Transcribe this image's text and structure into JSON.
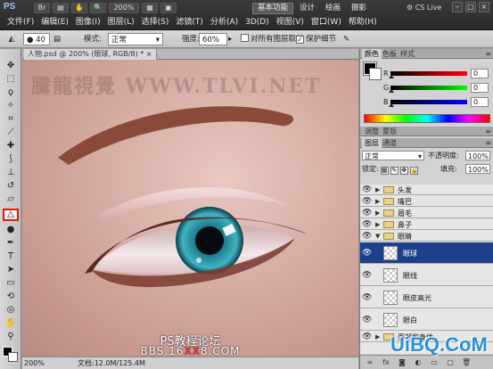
{
  "app": {
    "logo": "PS",
    "zoom": "200%",
    "cs_live": "CS Live"
  },
  "workspaces": [
    "基本功能",
    "设计",
    "绘画",
    "摄影"
  ],
  "menus": [
    "文件(F)",
    "编辑(E)",
    "图像(I)",
    "图层(L)",
    "选择(S)",
    "滤镜(T)",
    "分析(A)",
    "3D(D)",
    "视图(V)",
    "窗口(W)",
    "帮助(H)"
  ],
  "options": {
    "brush_size": "40",
    "mode_label": "模式:",
    "mode_value": "正常",
    "strength_label": "强度:",
    "strength_value": "60%",
    "sample_all_layers": "对所有图层取样",
    "protect_detail": "保护细节",
    "protect_detail_checked": true
  },
  "document": {
    "tab_label": "人物.psd @ 200% (眼球, RGB/8) *",
    "watermark": "騰龍視覺 WWW.TLVI.NET",
    "forum_title": "PS教程论坛",
    "forum_url_prefix": "BBS.16",
    "forum_url_red": "XX",
    "forum_url_suffix": "8.COM"
  },
  "status": {
    "zoom": "200%",
    "doc_size": "文档:12.0M/125.4M"
  },
  "color_panel": {
    "tabs": [
      "颜色",
      "色板",
      "样式"
    ],
    "r_label": "R",
    "g_label": "G",
    "b_label": "B",
    "r_value": "0",
    "g_value": "0",
    "b_value": "0"
  },
  "adjust_tabs": [
    "调整",
    "蒙版"
  ],
  "layers_panel": {
    "tabs": [
      "图层",
      "通道"
    ],
    "blend_mode": "正常",
    "opacity_label": "不透明度:",
    "opacity_value": "100%",
    "lock_label": "锁定:",
    "fill_label": "填充:",
    "fill_value": "100%",
    "layers": [
      {
        "name": "头发",
        "type": "group"
      },
      {
        "name": "嘴巴",
        "type": "group"
      },
      {
        "name": "眉毛",
        "type": "group"
      },
      {
        "name": "鼻子",
        "type": "group"
      },
      {
        "name": "眼睛",
        "type": "group"
      },
      {
        "name": "眼球",
        "type": "layer"
      },
      {
        "name": "眼线",
        "type": "layer"
      },
      {
        "name": "眼皮高光",
        "type": "layer"
      },
      {
        "name": "眼白",
        "type": "layer"
      },
      {
        "name": "面部和身体",
        "type": "group"
      }
    ]
  },
  "site_watermark": "UiBQ.CoM",
  "colors": {
    "selected_layer": "#1e3f8c",
    "tool_highlight": "#e01818",
    "iris": "#1f7f8f"
  },
  "icons": [
    "move-icon",
    "marquee-icon",
    "lasso-icon",
    "quick-select-icon",
    "crop-icon",
    "eyedropper-icon",
    "healing-icon",
    "brush-icon",
    "clone-stamp-icon",
    "history-brush-icon",
    "eraser-icon",
    "gradient-icon",
    "sharpen-icon",
    "dodge-icon",
    "pen-icon",
    "type-icon",
    "path-select-icon",
    "shape-icon",
    "3d-rotate-icon",
    "3d-orbit-icon",
    "hand-icon",
    "zoom-icon"
  ]
}
